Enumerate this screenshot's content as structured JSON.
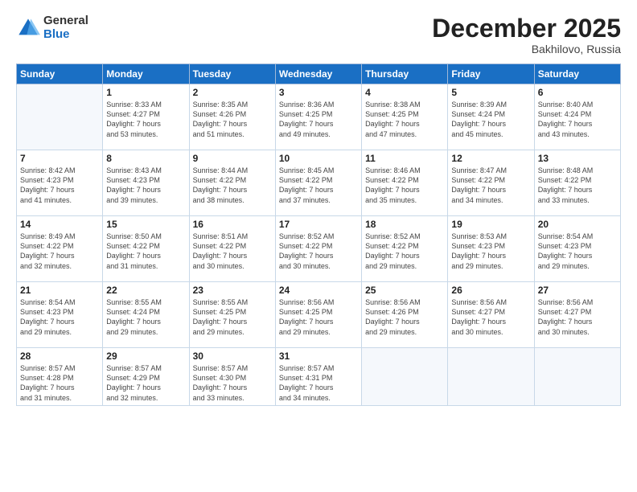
{
  "logo": {
    "general": "General",
    "blue": "Blue"
  },
  "header": {
    "month": "December 2025",
    "location": "Bakhilovo, Russia"
  },
  "weekdays": [
    "Sunday",
    "Monday",
    "Tuesday",
    "Wednesday",
    "Thursday",
    "Friday",
    "Saturday"
  ],
  "weeks": [
    [
      {
        "day": "",
        "info": ""
      },
      {
        "day": "1",
        "info": "Sunrise: 8:33 AM\nSunset: 4:27 PM\nDaylight: 7 hours\nand 53 minutes."
      },
      {
        "day": "2",
        "info": "Sunrise: 8:35 AM\nSunset: 4:26 PM\nDaylight: 7 hours\nand 51 minutes."
      },
      {
        "day": "3",
        "info": "Sunrise: 8:36 AM\nSunset: 4:25 PM\nDaylight: 7 hours\nand 49 minutes."
      },
      {
        "day": "4",
        "info": "Sunrise: 8:38 AM\nSunset: 4:25 PM\nDaylight: 7 hours\nand 47 minutes."
      },
      {
        "day": "5",
        "info": "Sunrise: 8:39 AM\nSunset: 4:24 PM\nDaylight: 7 hours\nand 45 minutes."
      },
      {
        "day": "6",
        "info": "Sunrise: 8:40 AM\nSunset: 4:24 PM\nDaylight: 7 hours\nand 43 minutes."
      }
    ],
    [
      {
        "day": "7",
        "info": "Sunrise: 8:42 AM\nSunset: 4:23 PM\nDaylight: 7 hours\nand 41 minutes."
      },
      {
        "day": "8",
        "info": "Sunrise: 8:43 AM\nSunset: 4:23 PM\nDaylight: 7 hours\nand 39 minutes."
      },
      {
        "day": "9",
        "info": "Sunrise: 8:44 AM\nSunset: 4:22 PM\nDaylight: 7 hours\nand 38 minutes."
      },
      {
        "day": "10",
        "info": "Sunrise: 8:45 AM\nSunset: 4:22 PM\nDaylight: 7 hours\nand 37 minutes."
      },
      {
        "day": "11",
        "info": "Sunrise: 8:46 AM\nSunset: 4:22 PM\nDaylight: 7 hours\nand 35 minutes."
      },
      {
        "day": "12",
        "info": "Sunrise: 8:47 AM\nSunset: 4:22 PM\nDaylight: 7 hours\nand 34 minutes."
      },
      {
        "day": "13",
        "info": "Sunrise: 8:48 AM\nSunset: 4:22 PM\nDaylight: 7 hours\nand 33 minutes."
      }
    ],
    [
      {
        "day": "14",
        "info": "Sunrise: 8:49 AM\nSunset: 4:22 PM\nDaylight: 7 hours\nand 32 minutes."
      },
      {
        "day": "15",
        "info": "Sunrise: 8:50 AM\nSunset: 4:22 PM\nDaylight: 7 hours\nand 31 minutes."
      },
      {
        "day": "16",
        "info": "Sunrise: 8:51 AM\nSunset: 4:22 PM\nDaylight: 7 hours\nand 30 minutes."
      },
      {
        "day": "17",
        "info": "Sunrise: 8:52 AM\nSunset: 4:22 PM\nDaylight: 7 hours\nand 30 minutes."
      },
      {
        "day": "18",
        "info": "Sunrise: 8:52 AM\nSunset: 4:22 PM\nDaylight: 7 hours\nand 29 minutes."
      },
      {
        "day": "19",
        "info": "Sunrise: 8:53 AM\nSunset: 4:23 PM\nDaylight: 7 hours\nand 29 minutes."
      },
      {
        "day": "20",
        "info": "Sunrise: 8:54 AM\nSunset: 4:23 PM\nDaylight: 7 hours\nand 29 minutes."
      }
    ],
    [
      {
        "day": "21",
        "info": "Sunrise: 8:54 AM\nSunset: 4:23 PM\nDaylight: 7 hours\nand 29 minutes."
      },
      {
        "day": "22",
        "info": "Sunrise: 8:55 AM\nSunset: 4:24 PM\nDaylight: 7 hours\nand 29 minutes."
      },
      {
        "day": "23",
        "info": "Sunrise: 8:55 AM\nSunset: 4:25 PM\nDaylight: 7 hours\nand 29 minutes."
      },
      {
        "day": "24",
        "info": "Sunrise: 8:56 AM\nSunset: 4:25 PM\nDaylight: 7 hours\nand 29 minutes."
      },
      {
        "day": "25",
        "info": "Sunrise: 8:56 AM\nSunset: 4:26 PM\nDaylight: 7 hours\nand 29 minutes."
      },
      {
        "day": "26",
        "info": "Sunrise: 8:56 AM\nSunset: 4:27 PM\nDaylight: 7 hours\nand 30 minutes."
      },
      {
        "day": "27",
        "info": "Sunrise: 8:56 AM\nSunset: 4:27 PM\nDaylight: 7 hours\nand 30 minutes."
      }
    ],
    [
      {
        "day": "28",
        "info": "Sunrise: 8:57 AM\nSunset: 4:28 PM\nDaylight: 7 hours\nand 31 minutes."
      },
      {
        "day": "29",
        "info": "Sunrise: 8:57 AM\nSunset: 4:29 PM\nDaylight: 7 hours\nand 32 minutes."
      },
      {
        "day": "30",
        "info": "Sunrise: 8:57 AM\nSunset: 4:30 PM\nDaylight: 7 hours\nand 33 minutes."
      },
      {
        "day": "31",
        "info": "Sunrise: 8:57 AM\nSunset: 4:31 PM\nDaylight: 7 hours\nand 34 minutes."
      },
      {
        "day": "",
        "info": ""
      },
      {
        "day": "",
        "info": ""
      },
      {
        "day": "",
        "info": ""
      }
    ]
  ]
}
